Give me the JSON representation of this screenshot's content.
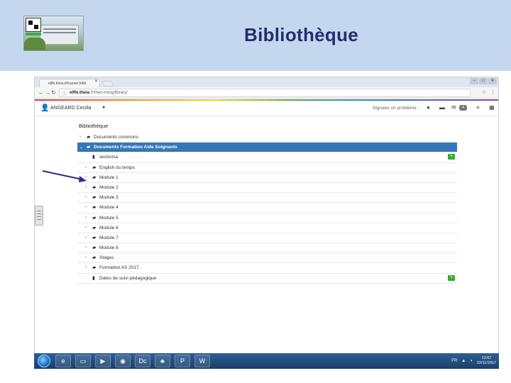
{
  "slide": {
    "title": "Bibliothèque"
  },
  "browser": {
    "tab_title": "elffe.theia.fr/lcarner.fr/lib",
    "tab_close": "✕",
    "url_host": "elffe.theia",
    "url_path": ".fr/theo-rning/library/",
    "window_controls": [
      "−",
      "□",
      "✕"
    ]
  },
  "userbar": {
    "user_name": "ANGEARD Cecilia",
    "report_problem": "Signaler un problème",
    "notification_count": "4"
  },
  "library": {
    "title": "Bibliothèque",
    "rows": [
      {
        "label": "Documents communs",
        "type": "folder",
        "expandable": true,
        "level": 0,
        "selected": false,
        "add": false
      },
      {
        "label": "Documents Formation Aide Soignants",
        "type": "folder",
        "expandable": true,
        "level": 0,
        "selected": true,
        "add": false
      },
      {
        "label": "sectorisa",
        "type": "file",
        "expandable": false,
        "level": 1,
        "selected": false,
        "add": true
      },
      {
        "label": "English du temps",
        "type": "folder",
        "expandable": true,
        "level": 1,
        "selected": false,
        "add": false
      },
      {
        "label": "Module 1",
        "type": "folder",
        "expandable": true,
        "level": 1,
        "selected": false,
        "add": false
      },
      {
        "label": "Module 2",
        "type": "folder",
        "expandable": true,
        "level": 1,
        "selected": false,
        "add": false
      },
      {
        "label": "Module 3",
        "type": "folder",
        "expandable": true,
        "level": 1,
        "selected": false,
        "add": false
      },
      {
        "label": "Module 4",
        "type": "folder",
        "expandable": true,
        "level": 1,
        "selected": false,
        "add": false
      },
      {
        "label": "Module 5",
        "type": "folder",
        "expandable": true,
        "level": 1,
        "selected": false,
        "add": false
      },
      {
        "label": "Module 6",
        "type": "folder",
        "expandable": true,
        "level": 1,
        "selected": false,
        "add": false
      },
      {
        "label": "Module 7",
        "type": "folder",
        "expandable": true,
        "level": 1,
        "selected": false,
        "add": false
      },
      {
        "label": "Module 8",
        "type": "folder",
        "expandable": true,
        "level": 1,
        "selected": false,
        "add": false
      },
      {
        "label": "Stages",
        "type": "folder",
        "expandable": true,
        "level": 1,
        "selected": false,
        "add": false
      },
      {
        "label": "Formation AS 2017",
        "type": "folder",
        "expandable": true,
        "level": 1,
        "selected": false,
        "add": false
      },
      {
        "label": "Dates de suivi pédagogique",
        "type": "file",
        "expandable": false,
        "level": 1,
        "selected": false,
        "add": true
      }
    ]
  },
  "taskbar": {
    "apps": [
      "e",
      "▭",
      "▶",
      "◉",
      "Dc",
      "♣",
      "P",
      "W"
    ],
    "tray_lang": "FR",
    "clock_time": "13:57",
    "clock_date": "22/11/2017"
  },
  "icons": {
    "back": "back-arrow-icon",
    "forward": "forward-arrow-icon",
    "reload": "reload-icon",
    "folder": "folder-icon",
    "file": "file-icon",
    "add": "plus-icon",
    "user": "user-icon",
    "info": "info-icon"
  },
  "colors": {
    "header_bg": "#c5d7ee",
    "title": "#1f2f6e",
    "selected_row": "#3377b8",
    "add_button": "#3aa53a",
    "taskbar": "#1c3f6a",
    "arrow": "#2b2f8c"
  }
}
